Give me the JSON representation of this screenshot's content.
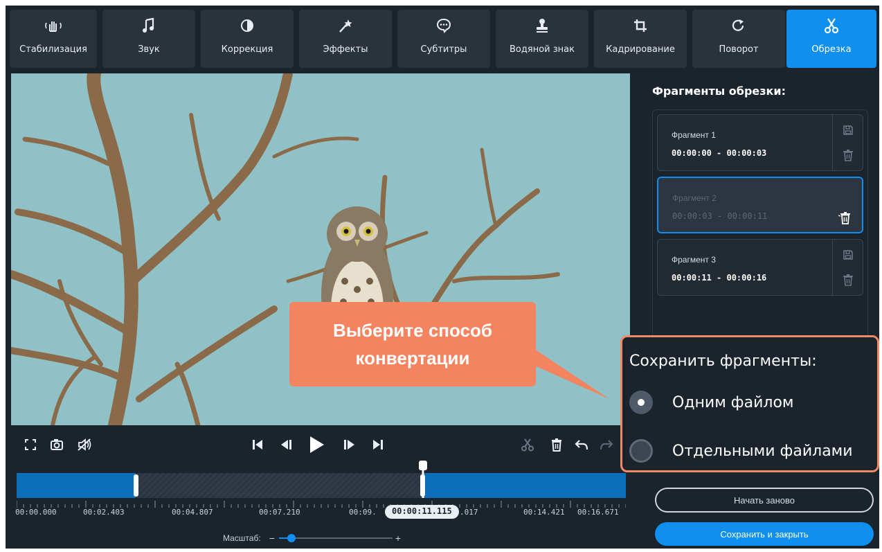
{
  "toolbar": {
    "tools": [
      {
        "label": "Стабилизация",
        "icon": "hand-stabilize-icon"
      },
      {
        "label": "Звук",
        "icon": "music-note-icon"
      },
      {
        "label": "Коррекция",
        "icon": "contrast-icon"
      },
      {
        "label": "Эффекты",
        "icon": "magic-wand-icon"
      },
      {
        "label": "Субтитры",
        "icon": "speech-bubble-icon"
      },
      {
        "label": "Водяной знак",
        "icon": "stamp-icon"
      },
      {
        "label": "Кадрирование",
        "icon": "crop-icon"
      },
      {
        "label": "Поворот",
        "icon": "rotate-icon"
      },
      {
        "label": "Обрезка",
        "icon": "scissors-icon",
        "active": true
      }
    ]
  },
  "panel": {
    "title": "Фрагменты обрезки:",
    "fragments": [
      {
        "name": "Фрагмент 1",
        "time": "00:00:00 - 00:00:03",
        "selected": false
      },
      {
        "name": "Фрагмент 2",
        "time": "00:00:03 - 00:00:11",
        "selected": true
      },
      {
        "name": "Фрагмент 3",
        "time": "00:00:11 - 00:00:16",
        "selected": false
      }
    ],
    "restart_label": "Начать заново",
    "save_label": "Сохранить и закрыть"
  },
  "save_options": {
    "title": "Сохранить фрагменты:",
    "options": [
      {
        "label": "Одним файлом",
        "selected": true
      },
      {
        "label": "Отдельными файлами",
        "selected": false
      }
    ]
  },
  "callout": {
    "text": "Выберите способ конвертации"
  },
  "timeline": {
    "ticks": [
      "00:00.000",
      "00:02.403",
      "00:04.807",
      "00:07.210",
      "00:09.",
      ".017",
      "00:14.421",
      "00:16.671"
    ],
    "current_time": "00:00:11.115",
    "zoom_label": "Масштаб:",
    "zoom_minus": "−",
    "zoom_plus": "+"
  },
  "colors": {
    "accent": "#0f8ff0",
    "callout": "#f4845f",
    "background": "#1b232c"
  }
}
